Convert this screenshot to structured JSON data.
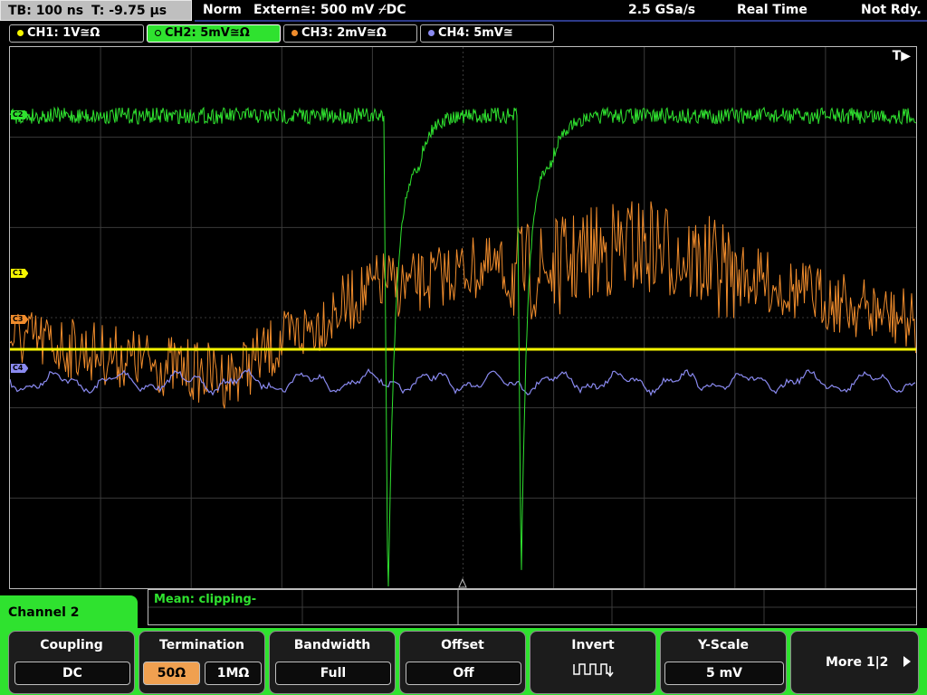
{
  "topbar": {
    "timebase": "TB: 100 ns",
    "trigger_time": "T: -9.75 µs",
    "mode": "Norm",
    "trigger": "Extern≅: 500 mV ⌿DC",
    "sample_rate": "2.5 GSa/s",
    "acq_mode": "Real Time",
    "status": "Not Rdy."
  },
  "channels": [
    {
      "label": "CH1: 1V≅Ω",
      "color": "#f5f500"
    },
    {
      "label": "CH2: 5mV≅Ω",
      "color": "#2fe22f"
    },
    {
      "label": "CH3: 2mV≅Ω",
      "color": "#f08c2c"
    },
    {
      "label": "CH4: 5mV≅",
      "color": "#8a8af0"
    }
  ],
  "markers": {
    "trigger": "T▶",
    "c1": "C1",
    "c2": "C2",
    "c3": "C3",
    "c4": "C4"
  },
  "measurement": {
    "label": "Mean: clipping-"
  },
  "panel": {
    "title": "Channel 2"
  },
  "softkeys": {
    "coupling": {
      "title": "Coupling",
      "value": "DC"
    },
    "termination": {
      "title": "Termination",
      "opt1": "50Ω",
      "opt2": "1MΩ"
    },
    "bandwidth": {
      "title": "Bandwidth",
      "value": "Full"
    },
    "offset": {
      "title": "Offset",
      "value": "Off"
    },
    "invert": {
      "title": "Invert"
    },
    "yscale": {
      "title": "Y-Scale",
      "value": "5 mV"
    },
    "more": "More 1|2"
  }
}
